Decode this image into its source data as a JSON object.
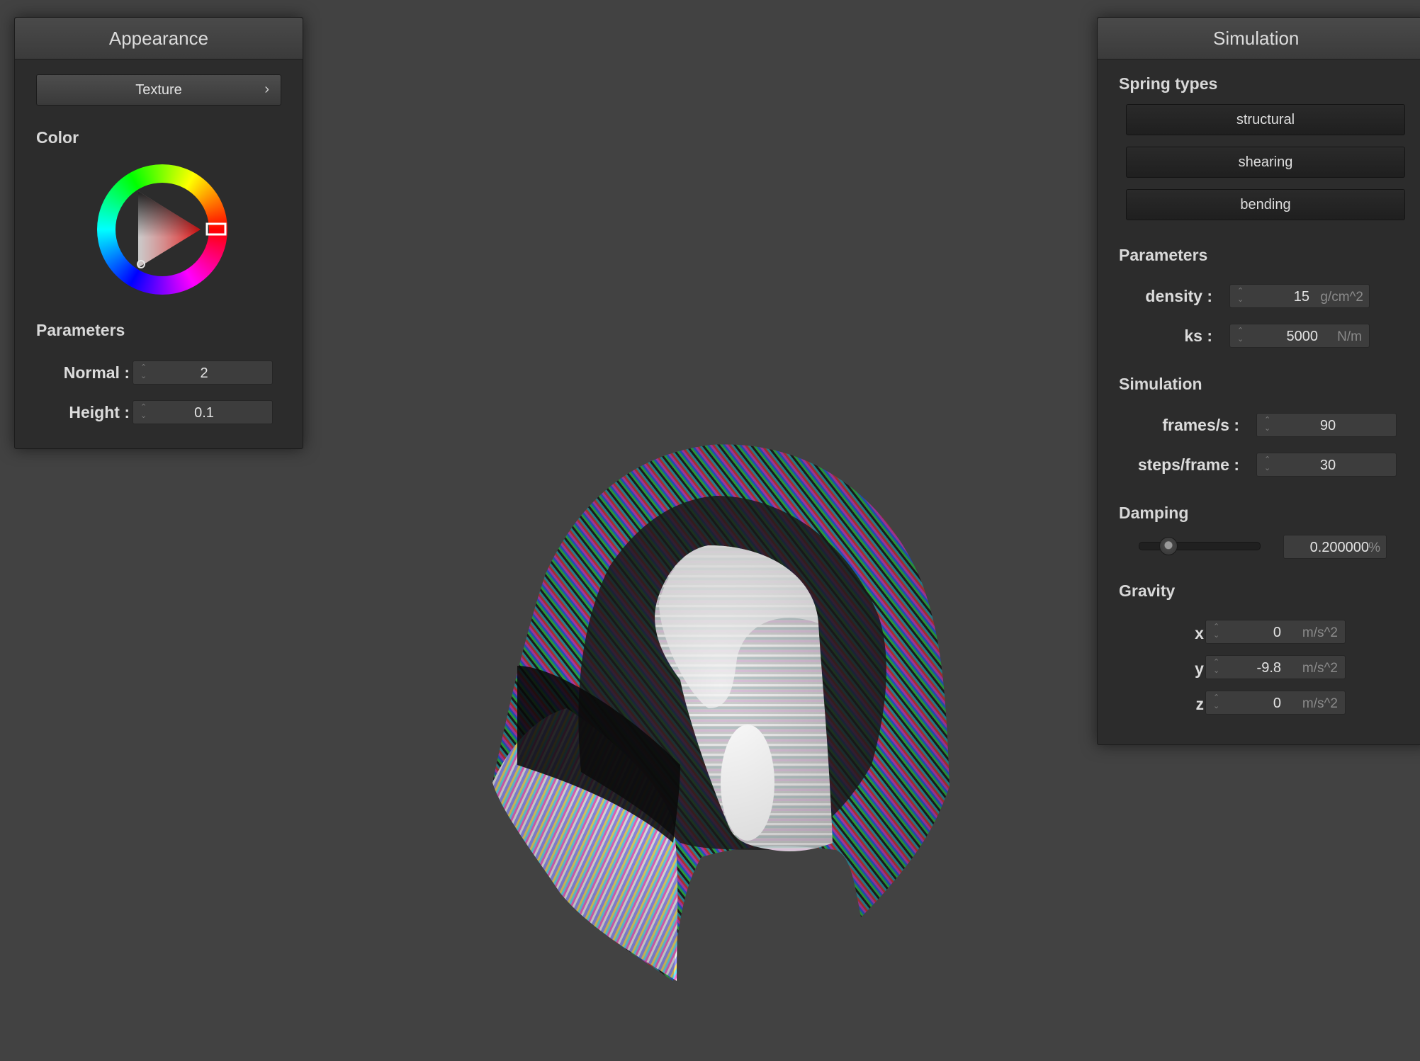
{
  "appearance": {
    "title": "Appearance",
    "texture_button": "Texture",
    "color_label": "Color",
    "params_label": "Parameters",
    "normal_label": "Normal :",
    "normal_value": "2",
    "height_label": "Height :",
    "height_value": "0.1",
    "selected_color": "#e01010"
  },
  "simulation_panel": {
    "title": "Simulation",
    "spring_types_label": "Spring types",
    "spring_buttons": [
      "structural",
      "shearing",
      "bending"
    ],
    "parameters_label": "Parameters",
    "density_label": "density :",
    "density_value": "15",
    "density_unit": "g/cm^2",
    "ks_label": "ks :",
    "ks_value": "5000",
    "ks_unit": "N/m",
    "simulation_label": "Simulation",
    "fps_label": "frames/s :",
    "fps_value": "90",
    "steps_label": "steps/frame :",
    "steps_value": "30",
    "damping_label": "Damping",
    "damping_value": "0.200000",
    "damping_unit": "%",
    "damping_slider_fraction": 0.2,
    "gravity_label": "Gravity",
    "gx_label": "x :",
    "gx_value": "0",
    "gy_label": "y :",
    "gy_value": "-9.8",
    "gz_label": "z :",
    "gz_value": "0",
    "gravity_unit": "m/s^2"
  },
  "colors": {
    "background": "#424242",
    "panel": "#2c2c2c"
  }
}
